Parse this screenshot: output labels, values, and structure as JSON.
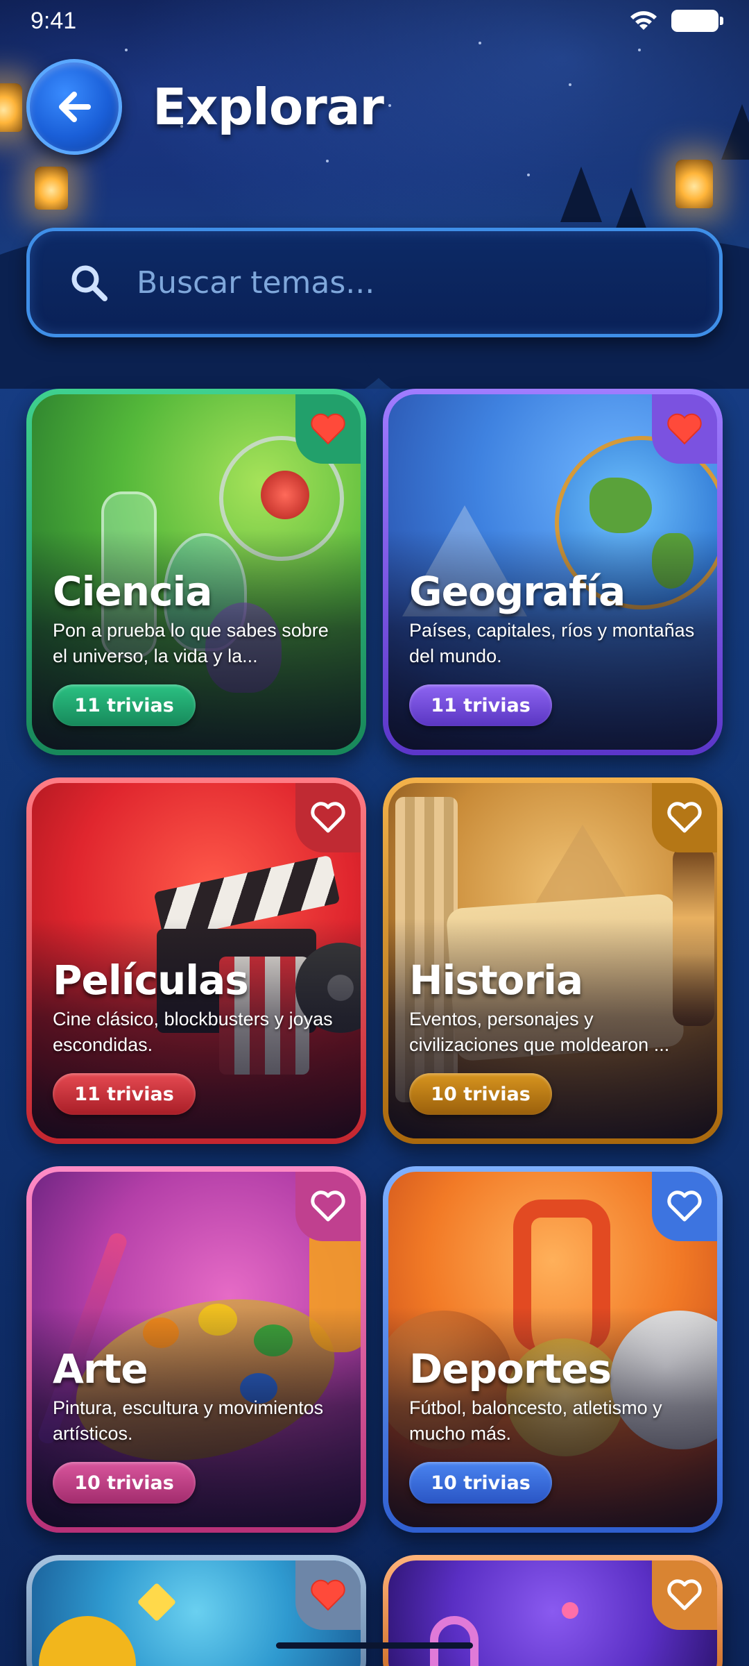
{
  "status_bar": {
    "time": "9:41"
  },
  "header": {
    "title": "Explorar"
  },
  "search": {
    "placeholder": "Buscar temas..."
  },
  "colors": {
    "ciencia": "#22a06b",
    "geografia": "#7b52e0",
    "peliculas": "#e0434b",
    "historia": "#c8861a",
    "arte": "#d54a98",
    "deportes": "#3d74e0"
  },
  "cards": [
    {
      "title": "Ciencia",
      "description": "Pon a prueba lo que sabes sobre el universo, la vida y la...",
      "count": "11 trivias",
      "favorite": true,
      "icon": "heart-filled-icon"
    },
    {
      "title": "Geografía",
      "description": "Países, capitales, ríos y montañas del mundo.",
      "count": "11 trivias",
      "favorite": true,
      "icon": "heart-filled-icon"
    },
    {
      "title": "Películas",
      "description": "Cine clásico, blockbusters y joyas escondidas.",
      "count": "11 trivias",
      "favorite": false,
      "icon": "heart-outline-icon"
    },
    {
      "title": "Historia",
      "description": "Eventos, personajes y civilizaciones que moldearon ...",
      "count": "10 trivias",
      "favorite": false,
      "icon": "heart-outline-icon"
    },
    {
      "title": "Arte",
      "description": "Pintura, escultura y movimientos artísticos.",
      "count": "10 trivias",
      "favorite": false,
      "icon": "heart-outline-icon"
    },
    {
      "title": "Deportes",
      "description": "Fútbol, baloncesto, atletismo y mucho más.",
      "count": "10 trivias",
      "favorite": false,
      "icon": "heart-outline-icon"
    },
    {
      "favorite": true,
      "icon": "heart-filled-icon"
    },
    {
      "favorite": false,
      "icon": "heart-outline-icon"
    }
  ]
}
